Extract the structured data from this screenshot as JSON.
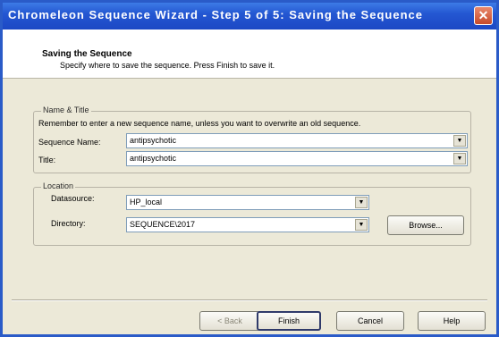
{
  "window": {
    "title": "Chromeleon Sequence Wizard - Step 5 of 5: Saving the Sequence",
    "close_glyph": "✕"
  },
  "header": {
    "title": "Saving the Sequence",
    "subtitle": "Specify where to save the sequence. Press Finish to save it."
  },
  "name_title_group": {
    "label": "Name & Title",
    "hint": "Remember to enter a new sequence name, unless you want to overwrite an old sequence.",
    "sequence_name_label": "Sequence Name:",
    "sequence_name_value": "antipsychotic",
    "title_label": "Title:",
    "title_value": "antipsychotic"
  },
  "location_group": {
    "label": "Location",
    "datasource_label": "Datasource:",
    "datasource_value": "HP_local",
    "directory_label": "Directory:",
    "directory_value": "SEQUENCE\\2017",
    "browse_label": "Browse..."
  },
  "footer": {
    "back_label": "< Back",
    "finish_label": "Finish",
    "cancel_label": "Cancel",
    "help_label": "Help"
  },
  "icons": {
    "dropdown_arrow": "▼"
  }
}
